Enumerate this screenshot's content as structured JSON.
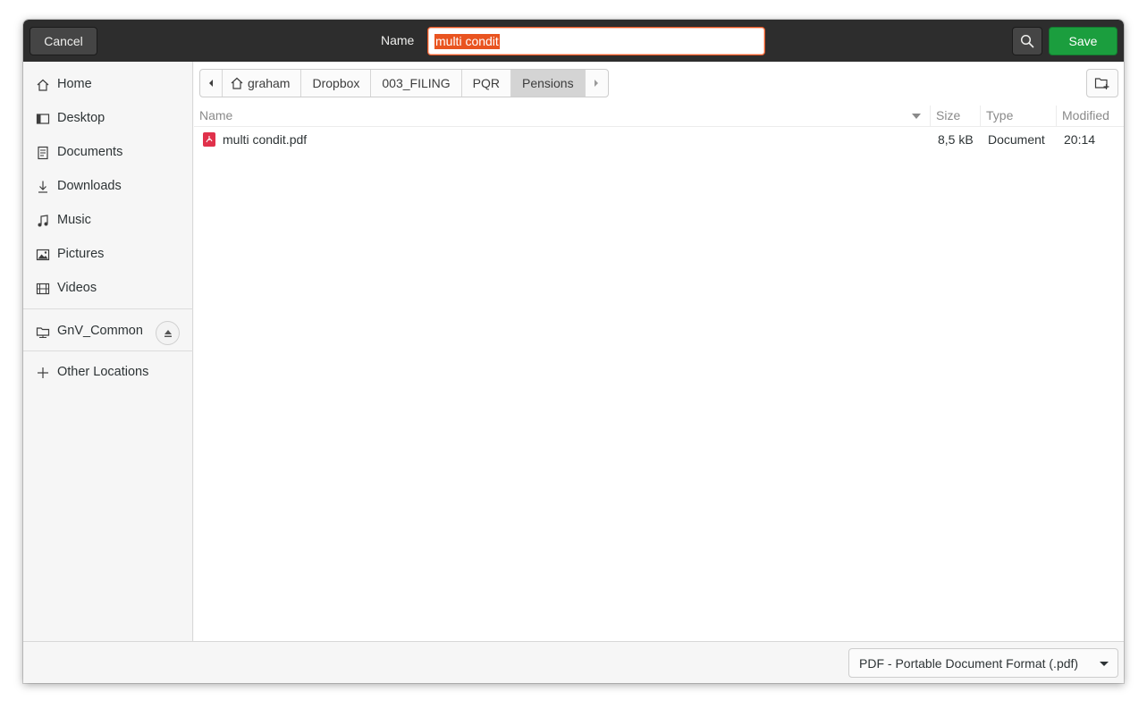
{
  "header": {
    "cancel_label": "Cancel",
    "name_label": "Name",
    "name_value": "multi condit",
    "save_label": "Save",
    "accent_color": "#e95420",
    "save_color": "#1b9e3e"
  },
  "sidebar": {
    "items": [
      {
        "label": "Home",
        "icon": "home-icon"
      },
      {
        "label": "Desktop",
        "icon": "desktop-icon"
      },
      {
        "label": "Documents",
        "icon": "documents-icon"
      },
      {
        "label": "Downloads",
        "icon": "downloads-icon"
      },
      {
        "label": "Music",
        "icon": "music-icon"
      },
      {
        "label": "Pictures",
        "icon": "pictures-icon"
      },
      {
        "label": "Videos",
        "icon": "videos-icon"
      }
    ],
    "network_drive": {
      "label": "GnV_Common",
      "icon": "network-drive-icon"
    },
    "other_locations": {
      "label": "Other Locations",
      "icon": "plus-icon"
    }
  },
  "pathbar": {
    "segments": [
      "graham",
      "Dropbox",
      "003_FILING",
      "PQR",
      "Pensions"
    ],
    "active": "Pensions"
  },
  "table": {
    "columns": [
      "Name",
      "Size",
      "Type",
      "Modified"
    ],
    "rows": [
      {
        "name": "multi condit.pdf",
        "size": "8,5 kB",
        "type": "Document",
        "modified": "20:14",
        "icon": "pdf-icon"
      }
    ]
  },
  "footer": {
    "filetype": "PDF - Portable Document Format (.pdf)"
  }
}
